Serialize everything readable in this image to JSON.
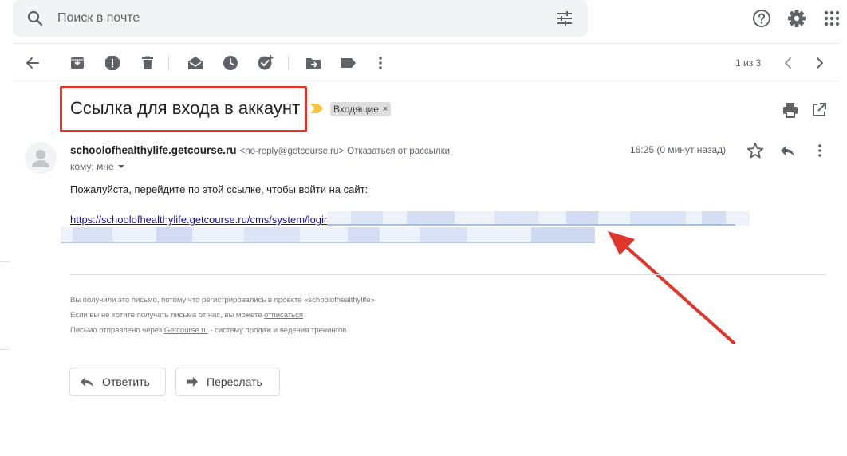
{
  "search": {
    "placeholder": "Поиск в почте"
  },
  "pager": {
    "text": "1 из 3"
  },
  "email": {
    "subject": "Ссылка для входа в аккаунт",
    "label": "Входящие",
    "label_close": "×",
    "sender_name": "schoolofhealthylife.getcourse.ru",
    "sender_email": "<no-reply@getcourse.ru>",
    "unsubscribe": "Отказаться от рассылки",
    "time": "16:25 (0 минут назад)",
    "recipient": "кому: мне",
    "body_intro": "Пожалуйста, перейдите по этой ссылке, чтобы войти на сайт:",
    "login_link": "https://schoolofhealthylife.getcourse.ru/cms/system/login",
    "footer": {
      "line1": "Вы получили это письмо, потому что регистрировались в проекте «schoolofhealthylife»",
      "line2_text": "Если вы не хотите получать письма от нас, вы можете ",
      "line2_link": "отписаться",
      "line3_pre": "Письмо отправлено через ",
      "line3_link": "Getcourse.ru",
      "line3_post": " - систему продаж и ведения тренингов"
    }
  },
  "actions": {
    "reply": "Ответить",
    "forward": "Переслать"
  },
  "colors": {
    "annotation_red": "#e0352b",
    "link_blue": "#1a0dab",
    "important_yellow": "#f4c542",
    "icon_gray": "#5f6368"
  }
}
